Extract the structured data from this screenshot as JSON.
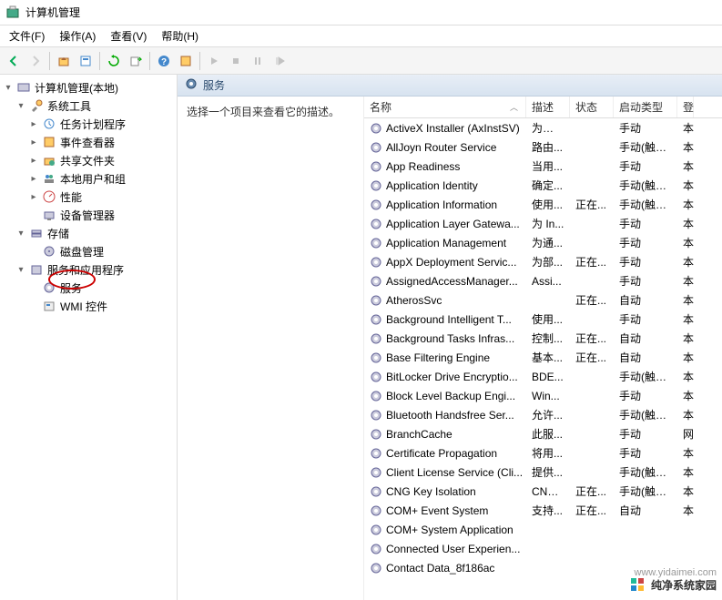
{
  "window": {
    "title": "计算机管理"
  },
  "menu": {
    "file": "文件(F)",
    "action": "操作(A)",
    "view": "查看(V)",
    "help": "帮助(H)"
  },
  "tree": {
    "root": "计算机管理(本地)",
    "system_tools": "系统工具",
    "task_scheduler": "任务计划程序",
    "event_viewer": "事件查看器",
    "shared_folders": "共享文件夹",
    "local_users": "本地用户和组",
    "performance": "性能",
    "device_manager": "设备管理器",
    "storage": "存储",
    "disk_management": "磁盘管理",
    "services_apps": "服务和应用程序",
    "services": "服务",
    "wmi": "WMI 控件"
  },
  "content": {
    "header": "服务",
    "desc_prompt": "选择一个项目来查看它的描述。",
    "columns": {
      "name": "名称",
      "desc": "描述",
      "status": "状态",
      "start": "启动类型",
      "login": "登"
    },
    "truncated": "本"
  },
  "services": [
    {
      "name": "ActiveX Installer (AxInstSV)",
      "desc": "为从 ...",
      "status": "",
      "start": "手动",
      "login": "本"
    },
    {
      "name": "AllJoyn Router Service",
      "desc": "路由...",
      "status": "",
      "start": "手动(触发...",
      "login": "本"
    },
    {
      "name": "App Readiness",
      "desc": "当用...",
      "status": "",
      "start": "手动",
      "login": "本"
    },
    {
      "name": "Application Identity",
      "desc": "确定...",
      "status": "",
      "start": "手动(触发...",
      "login": "本"
    },
    {
      "name": "Application Information",
      "desc": "使用...",
      "status": "正在...",
      "start": "手动(触发...",
      "login": "本"
    },
    {
      "name": "Application Layer Gatewa...",
      "desc": "为 In...",
      "status": "",
      "start": "手动",
      "login": "本"
    },
    {
      "name": "Application Management",
      "desc": "为通...",
      "status": "",
      "start": "手动",
      "login": "本"
    },
    {
      "name": "AppX Deployment Servic...",
      "desc": "为部...",
      "status": "正在...",
      "start": "手动",
      "login": "本"
    },
    {
      "name": "AssignedAccessManager...",
      "desc": "Assi...",
      "status": "",
      "start": "手动",
      "login": "本"
    },
    {
      "name": "AtherosSvc",
      "desc": "",
      "status": "正在...",
      "start": "自动",
      "login": "本"
    },
    {
      "name": "Background Intelligent T...",
      "desc": "使用...",
      "status": "",
      "start": "手动",
      "login": "本"
    },
    {
      "name": "Background Tasks Infras...",
      "desc": "控制...",
      "status": "正在...",
      "start": "自动",
      "login": "本"
    },
    {
      "name": "Base Filtering Engine",
      "desc": "基本...",
      "status": "正在...",
      "start": "自动",
      "login": "本"
    },
    {
      "name": "BitLocker Drive Encryptio...",
      "desc": "BDE...",
      "status": "",
      "start": "手动(触发...",
      "login": "本"
    },
    {
      "name": "Block Level Backup Engi...",
      "desc": "Win...",
      "status": "",
      "start": "手动",
      "login": "本"
    },
    {
      "name": "Bluetooth Handsfree Ser...",
      "desc": "允许...",
      "status": "",
      "start": "手动(触发...",
      "login": "本"
    },
    {
      "name": "BranchCache",
      "desc": "此服...",
      "status": "",
      "start": "手动",
      "login": "网"
    },
    {
      "name": "Certificate Propagation",
      "desc": "将用...",
      "status": "",
      "start": "手动",
      "login": "本"
    },
    {
      "name": "Client License Service (Cli...",
      "desc": "提供...",
      "status": "",
      "start": "手动(触发...",
      "login": "本"
    },
    {
      "name": "CNG Key Isolation",
      "desc": "CNG...",
      "status": "正在...",
      "start": "手动(触发...",
      "login": "本"
    },
    {
      "name": "COM+ Event System",
      "desc": "支持...",
      "status": "正在...",
      "start": "自动",
      "login": "本"
    },
    {
      "name": "COM+ System Application",
      "desc": "",
      "status": "",
      "start": "",
      "login": ""
    },
    {
      "name": "Connected User Experien...",
      "desc": "",
      "status": "",
      "start": "",
      "login": ""
    },
    {
      "name": "Contact Data_8f186ac",
      "desc": "",
      "status": "",
      "start": "",
      "login": ""
    }
  ],
  "watermark": {
    "text": "纯净系统家园",
    "url": "www.yidaimei.com"
  }
}
